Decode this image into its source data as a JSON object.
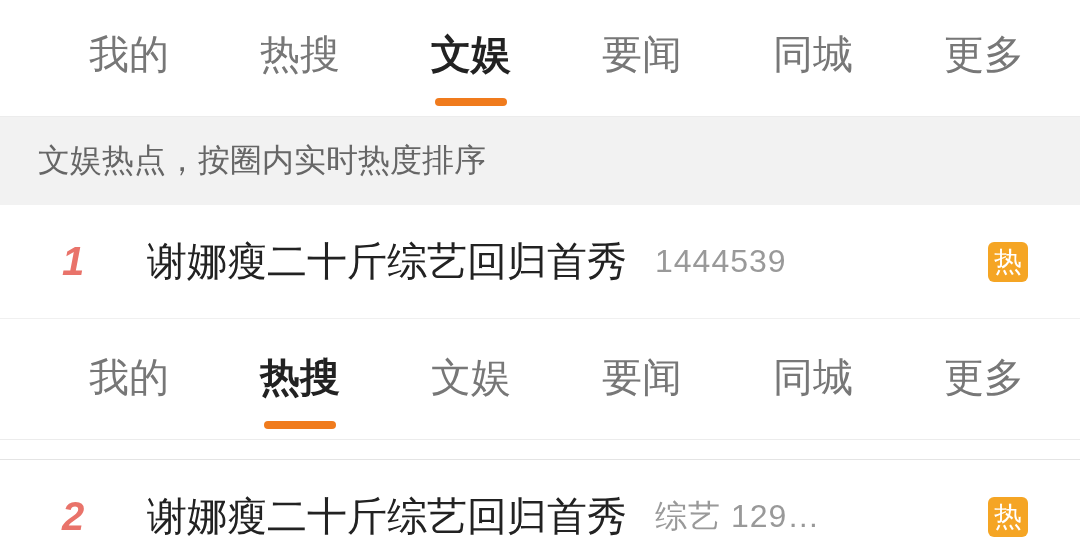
{
  "panels": [
    {
      "tabs": [
        {
          "label": "我的",
          "selected": false
        },
        {
          "label": "热搜",
          "selected": false
        },
        {
          "label": "文娱",
          "selected": true
        },
        {
          "label": "要闻",
          "selected": false
        },
        {
          "label": "同城",
          "selected": false
        },
        {
          "label": "更多",
          "selected": false
        }
      ],
      "banner": "文娱热点，按圈内实时热度排序",
      "rows": [
        {
          "rank": "1",
          "title": "谢娜瘦二十斤综艺回归首秀",
          "meta": "1444539",
          "badge": "热"
        }
      ]
    },
    {
      "tabs": [
        {
          "label": "我的",
          "selected": false
        },
        {
          "label": "热搜",
          "selected": true
        },
        {
          "label": "文娱",
          "selected": false
        },
        {
          "label": "要闻",
          "selected": false
        },
        {
          "label": "同城",
          "selected": false
        },
        {
          "label": "更多",
          "selected": false
        }
      ],
      "rows": [
        {
          "rank": "2",
          "title": "谢娜瘦二十斤综艺回归首秀",
          "meta": "综艺 129…",
          "badge": "热"
        }
      ]
    }
  ]
}
